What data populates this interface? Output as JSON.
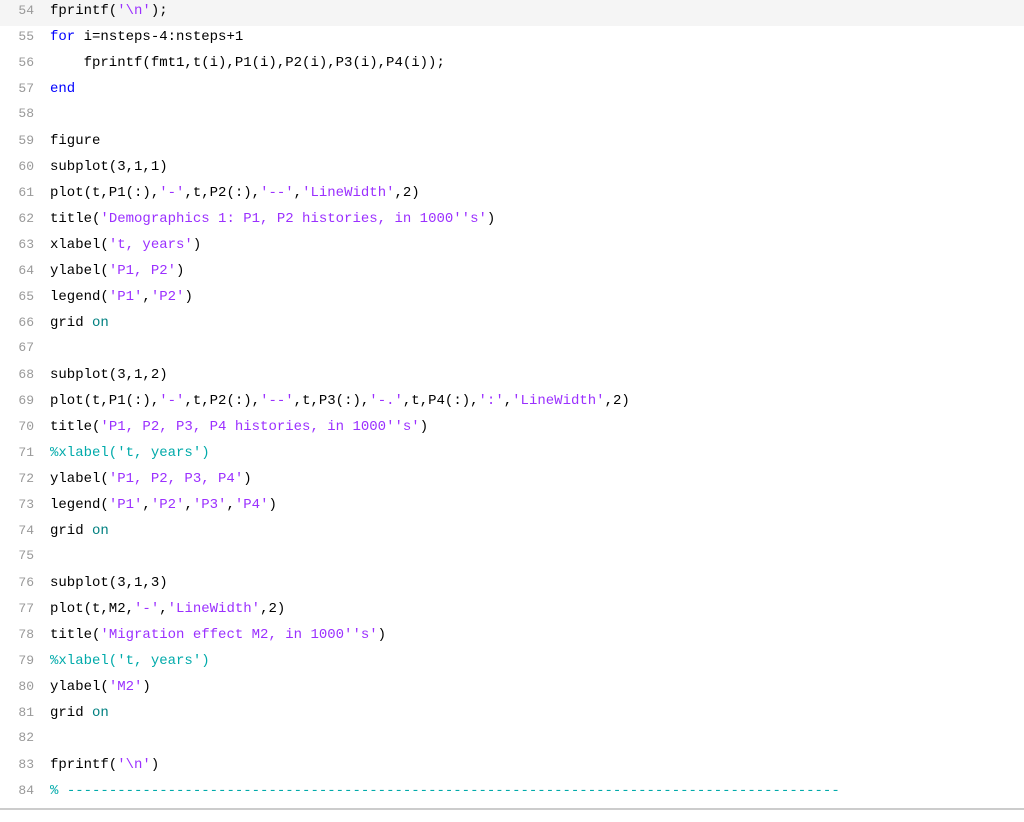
{
  "editor": {
    "lines": [
      {
        "num": 54,
        "tokens": [
          {
            "text": "fprintf(",
            "color": "default"
          },
          {
            "text": "'\\n'",
            "color": "purple"
          },
          {
            "text": ");",
            "color": "default"
          }
        ]
      },
      {
        "num": 55,
        "tokens": [
          {
            "text": "for",
            "color": "blue"
          },
          {
            "text": " i=nsteps-4:nsteps+1",
            "color": "default"
          }
        ]
      },
      {
        "num": 56,
        "tokens": [
          {
            "text": "    fprintf(fmt1,t(i),P1(i),P2(i),P3(i),P4(i));",
            "color": "default"
          }
        ]
      },
      {
        "num": 57,
        "tokens": [
          {
            "text": "end",
            "color": "blue"
          }
        ]
      },
      {
        "num": 58,
        "tokens": [
          {
            "text": "",
            "color": "default"
          }
        ]
      },
      {
        "num": 59,
        "tokens": [
          {
            "text": "figure",
            "color": "default"
          }
        ]
      },
      {
        "num": 60,
        "tokens": [
          {
            "text": "subplot(3,1,1)",
            "color": "default"
          }
        ]
      },
      {
        "num": 61,
        "tokens": [
          {
            "text": "plot(t,P1(:),",
            "color": "default"
          },
          {
            "text": "'-'",
            "color": "purple"
          },
          {
            "text": ",t,P2(:),",
            "color": "default"
          },
          {
            "text": "'--'",
            "color": "purple"
          },
          {
            "text": ",",
            "color": "default"
          },
          {
            "text": "'LineWidth'",
            "color": "purple"
          },
          {
            "text": ",2)",
            "color": "default"
          }
        ]
      },
      {
        "num": 62,
        "tokens": [
          {
            "text": "title(",
            "color": "default"
          },
          {
            "text": "'Demographics 1: P1, P2 histories, in 1000''s'",
            "color": "purple"
          },
          {
            "text": ")",
            "color": "default"
          }
        ]
      },
      {
        "num": 63,
        "tokens": [
          {
            "text": "xlabel(",
            "color": "default"
          },
          {
            "text": "'t, years'",
            "color": "purple"
          },
          {
            "text": ")",
            "color": "default"
          }
        ]
      },
      {
        "num": 64,
        "tokens": [
          {
            "text": "ylabel(",
            "color": "default"
          },
          {
            "text": "'P1, P2'",
            "color": "purple"
          },
          {
            "text": ")",
            "color": "default"
          }
        ]
      },
      {
        "num": 65,
        "tokens": [
          {
            "text": "legend(",
            "color": "default"
          },
          {
            "text": "'P1'",
            "color": "purple"
          },
          {
            "text": ",",
            "color": "default"
          },
          {
            "text": "'P2'",
            "color": "purple"
          },
          {
            "text": ")",
            "color": "default"
          }
        ]
      },
      {
        "num": 66,
        "tokens": [
          {
            "text": "grid ",
            "color": "default"
          },
          {
            "text": "on",
            "color": "cyan"
          }
        ]
      },
      {
        "num": 67,
        "tokens": [
          {
            "text": "",
            "color": "default"
          }
        ]
      },
      {
        "num": 68,
        "tokens": [
          {
            "text": "subplot(3,1,2)",
            "color": "default"
          }
        ]
      },
      {
        "num": 69,
        "tokens": [
          {
            "text": "plot(t,P1(:),",
            "color": "default"
          },
          {
            "text": "'-'",
            "color": "purple"
          },
          {
            "text": ",t,P2(:),",
            "color": "default"
          },
          {
            "text": "'--'",
            "color": "purple"
          },
          {
            "text": ",t,P3(:),",
            "color": "default"
          },
          {
            "text": "'-.'",
            "color": "purple"
          },
          {
            "text": ",t,P4(:),",
            "color": "default"
          },
          {
            "text": "':'",
            "color": "purple"
          },
          {
            "text": ",",
            "color": "default"
          },
          {
            "text": "'LineWidth'",
            "color": "purple"
          },
          {
            "text": ",2)",
            "color": "default"
          }
        ]
      },
      {
        "num": 70,
        "tokens": [
          {
            "text": "title(",
            "color": "default"
          },
          {
            "text": "'P1, P2, P3, P4 histories, in 1000''s'",
            "color": "purple"
          },
          {
            "text": ")",
            "color": "default"
          }
        ]
      },
      {
        "num": 71,
        "tokens": [
          {
            "text": "%xlabel(",
            "color": "comment"
          },
          {
            "text": "'t, years'",
            "color": "comment"
          },
          {
            "text": ")",
            "color": "comment"
          }
        ]
      },
      {
        "num": 72,
        "tokens": [
          {
            "text": "ylabel(",
            "color": "default"
          },
          {
            "text": "'P1, P2, P3, P4'",
            "color": "purple"
          },
          {
            "text": ")",
            "color": "default"
          }
        ]
      },
      {
        "num": 73,
        "tokens": [
          {
            "text": "legend(",
            "color": "default"
          },
          {
            "text": "'P1'",
            "color": "purple"
          },
          {
            "text": ",",
            "color": "default"
          },
          {
            "text": "'P2'",
            "color": "purple"
          },
          {
            "text": ",",
            "color": "default"
          },
          {
            "text": "'P3'",
            "color": "purple"
          },
          {
            "text": ",",
            "color": "default"
          },
          {
            "text": "'P4'",
            "color": "purple"
          },
          {
            "text": ")",
            "color": "default"
          }
        ]
      },
      {
        "num": 74,
        "tokens": [
          {
            "text": "grid ",
            "color": "default"
          },
          {
            "text": "on",
            "color": "cyan"
          }
        ]
      },
      {
        "num": 75,
        "tokens": [
          {
            "text": "",
            "color": "default"
          }
        ]
      },
      {
        "num": 76,
        "tokens": [
          {
            "text": "subplot(3,1,3)",
            "color": "default"
          }
        ]
      },
      {
        "num": 77,
        "tokens": [
          {
            "text": "plot(t,M2,",
            "color": "default"
          },
          {
            "text": "'-'",
            "color": "purple"
          },
          {
            "text": ",",
            "color": "default"
          },
          {
            "text": "'LineWidth'",
            "color": "purple"
          },
          {
            "text": ",2)",
            "color": "default"
          }
        ]
      },
      {
        "num": 78,
        "tokens": [
          {
            "text": "title(",
            "color": "default"
          },
          {
            "text": "'Migration effect M2, in 1000''s'",
            "color": "purple"
          },
          {
            "text": ")",
            "color": "default"
          }
        ]
      },
      {
        "num": 79,
        "tokens": [
          {
            "text": "%xlabel(",
            "color": "comment"
          },
          {
            "text": "'t, years'",
            "color": "comment"
          },
          {
            "text": ")",
            "color": "comment"
          }
        ]
      },
      {
        "num": 80,
        "tokens": [
          {
            "text": "ylabel(",
            "color": "default"
          },
          {
            "text": "'M2'",
            "color": "purple"
          },
          {
            "text": ")",
            "color": "default"
          }
        ]
      },
      {
        "num": 81,
        "tokens": [
          {
            "text": "grid ",
            "color": "default"
          },
          {
            "text": "on",
            "color": "cyan"
          }
        ]
      },
      {
        "num": 82,
        "tokens": [
          {
            "text": "",
            "color": "default"
          }
        ]
      },
      {
        "num": 83,
        "tokens": [
          {
            "text": "fprintf(",
            "color": "default"
          },
          {
            "text": "'\\n'",
            "color": "purple"
          },
          {
            "text": ")",
            "color": "default"
          }
        ]
      },
      {
        "num": 84,
        "tokens": [
          {
            "text": "% ",
            "color": "comment"
          },
          {
            "text": "--------------------------------------------------------------------------------------------",
            "color": "comment"
          }
        ]
      }
    ]
  }
}
